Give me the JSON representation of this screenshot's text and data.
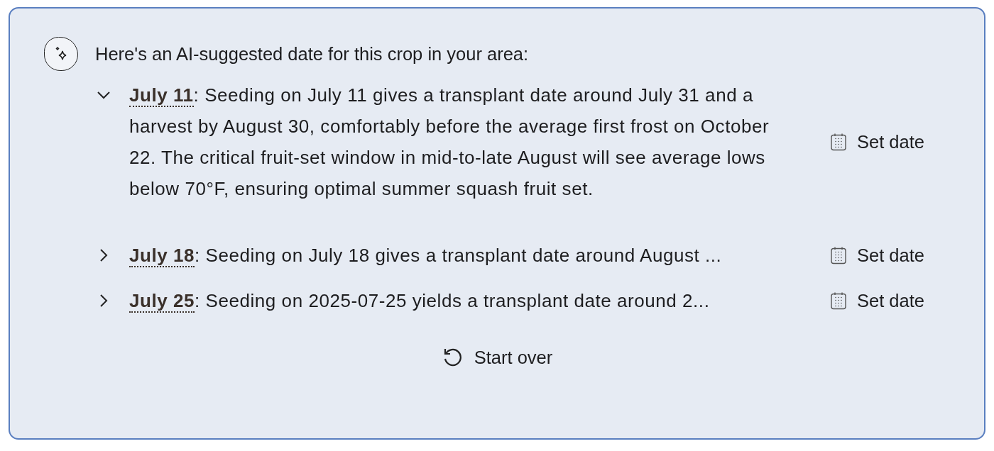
{
  "intro": "Here's an AI-suggested date for this crop in your area:",
  "suggestions": [
    {
      "date": "July 11",
      "text": ": Seeding on July 11 gives a transplant date around July 31 and a harvest by August 30, comfortably before the average first frost on October 22. The critical fruit-set window in mid-to-late August will see average lows below 70°F, ensuring optimal summer squash fruit set.",
      "expanded": true,
      "action": "Set date"
    },
    {
      "date": "July 18",
      "text": ": Seeding on July 18 gives a transplant date around August ...",
      "expanded": false,
      "action": "Set date"
    },
    {
      "date": "July 25",
      "text": ": Seeding on 2025-07-25 yields a transplant date around 2...",
      "expanded": false,
      "action": "Set date"
    }
  ],
  "start_over": "Start over"
}
